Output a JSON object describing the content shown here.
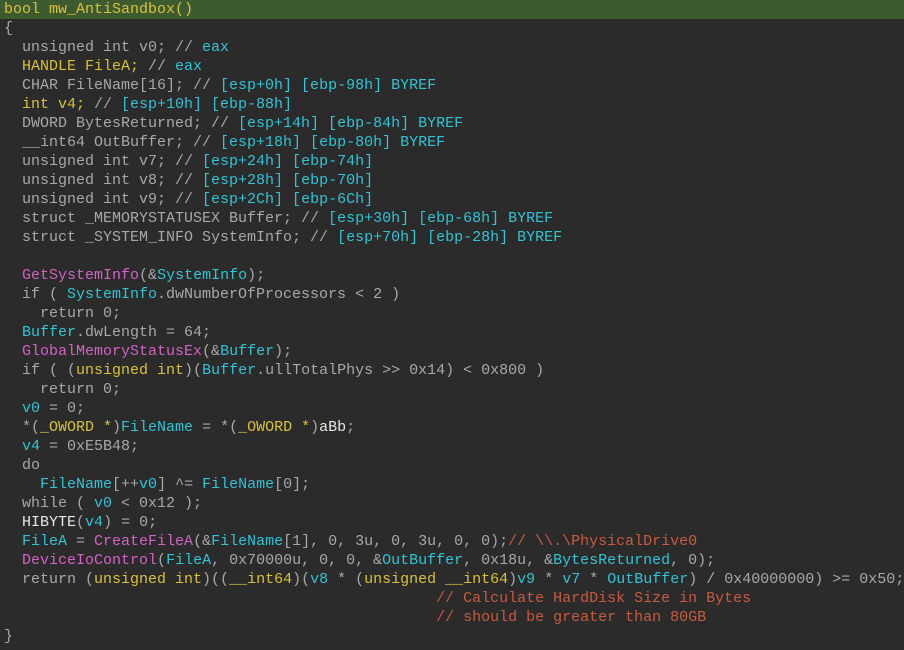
{
  "view": "pseudocode",
  "colors": {
    "background": "#2b2b2b",
    "header_bg": "#3e5b30",
    "text": "#a8a8a8",
    "keyword_type": "#d9c13a",
    "identifier": "#2fc4d6",
    "function": "#d361c6",
    "comment": "#c95a3e"
  },
  "code": {
    "lines": [
      [
        [
          "bool mw_AntiSandbox()",
          "y"
        ]
      ],
      [
        [
          "{",
          "g"
        ]
      ],
      [
        [
          "  unsigned int v0; // ",
          "g"
        ],
        [
          "eax",
          "c"
        ]
      ],
      [
        [
          "  HANDLE FileA; ",
          "y"
        ],
        [
          "// ",
          "g"
        ],
        [
          "eax",
          "c"
        ]
      ],
      [
        [
          "  CHAR FileName[16]; // ",
          "g"
        ],
        [
          "[esp+0h] [ebp-98h] BYREF",
          "c"
        ]
      ],
      [
        [
          "  int v4; ",
          "y"
        ],
        [
          "// ",
          "g"
        ],
        [
          "[esp+10h] [ebp-88h]",
          "c"
        ]
      ],
      [
        [
          "  DWORD BytesReturned; // ",
          "g"
        ],
        [
          "[esp+14h] [ebp-84h] BYREF",
          "c"
        ]
      ],
      [
        [
          "  __int64 OutBuffer; // ",
          "g"
        ],
        [
          "[esp+18h] [ebp-80h] BYREF",
          "c"
        ]
      ],
      [
        [
          "  unsigned int v7; // ",
          "g"
        ],
        [
          "[esp+24h] [ebp-74h]",
          "c"
        ]
      ],
      [
        [
          "  unsigned int v8; // ",
          "g"
        ],
        [
          "[esp+28h] [ebp-70h]",
          "c"
        ]
      ],
      [
        [
          "  unsigned int v9; // ",
          "g"
        ],
        [
          "[esp+2Ch] [ebp-6Ch]",
          "c"
        ]
      ],
      [
        [
          "  struct _MEMORYSTATUSEX Buffer; // ",
          "g"
        ],
        [
          "[esp+30h] [ebp-68h] BYREF",
          "c"
        ]
      ],
      [
        [
          "  struct _SYSTEM_INFO SystemInfo; // ",
          "g"
        ],
        [
          "[esp+70h] [ebp-28h] BYREF",
          "c"
        ]
      ],
      [
        [
          "",
          "g"
        ]
      ],
      [
        [
          "  ",
          "g"
        ],
        [
          "GetSystemInfo",
          "p"
        ],
        [
          "(&",
          "g"
        ],
        [
          "SystemInfo",
          "c"
        ],
        [
          ");",
          "g"
        ]
      ],
      [
        [
          "  if ( ",
          "g"
        ],
        [
          "SystemInfo",
          "c"
        ],
        [
          ".dwNumberOfProcessors < 2 )",
          "g"
        ]
      ],
      [
        [
          "    return 0;",
          "g"
        ]
      ],
      [
        [
          "  ",
          "g"
        ],
        [
          "Buffer",
          "c"
        ],
        [
          ".dwLength = 64;",
          "g"
        ]
      ],
      [
        [
          "  ",
          "g"
        ],
        [
          "GlobalMemoryStatusEx",
          "p"
        ],
        [
          "(&",
          "g"
        ],
        [
          "Buffer",
          "c"
        ],
        [
          ");",
          "g"
        ]
      ],
      [
        [
          "  if ( (",
          "g"
        ],
        [
          "unsigned int",
          "y"
        ],
        [
          ")(",
          "g"
        ],
        [
          "Buffer",
          "c"
        ],
        [
          ".ullTotalPhys >> 0x14) < 0x800 )",
          "g"
        ]
      ],
      [
        [
          "    return 0;",
          "g"
        ]
      ],
      [
        [
          "  ",
          "g"
        ],
        [
          "v0",
          "c"
        ],
        [
          " = 0;",
          "g"
        ]
      ],
      [
        [
          "  *(",
          "g"
        ],
        [
          "_OWORD *",
          "y"
        ],
        [
          ")",
          "g"
        ],
        [
          "FileName",
          "c"
        ],
        [
          " = *(",
          "g"
        ],
        [
          "_OWORD *",
          "y"
        ],
        [
          ")",
          "g"
        ],
        [
          "aBb",
          "w"
        ],
        [
          ";",
          "g"
        ]
      ],
      [
        [
          "  ",
          "g"
        ],
        [
          "v4",
          "c"
        ],
        [
          " = 0xE5B48;",
          "g"
        ]
      ],
      [
        [
          "  do",
          "g"
        ]
      ],
      [
        [
          "    ",
          "g"
        ],
        [
          "FileName",
          "c"
        ],
        [
          "[++",
          "g"
        ],
        [
          "v0",
          "c"
        ],
        [
          "] ^= ",
          "g"
        ],
        [
          "FileName",
          "c"
        ],
        [
          "[0];",
          "g"
        ]
      ],
      [
        [
          "  while ( ",
          "g"
        ],
        [
          "v0",
          "c"
        ],
        [
          " < 0x12 );",
          "g"
        ]
      ],
      [
        [
          "  ",
          "g"
        ],
        [
          "HIBYTE",
          "w"
        ],
        [
          "(",
          "g"
        ],
        [
          "v4",
          "c"
        ],
        [
          ") = 0;",
          "g"
        ]
      ],
      [
        [
          "  ",
          "g"
        ],
        [
          "FileA",
          "c"
        ],
        [
          " = ",
          "g"
        ],
        [
          "CreateFileA",
          "p"
        ],
        [
          "(&",
          "g"
        ],
        [
          "FileName",
          "c"
        ],
        [
          "[1], 0, 3u, 0, 3u, 0, 0);",
          "g"
        ],
        [
          "// \\\\.\\PhysicalDrive0",
          "r"
        ]
      ],
      [
        [
          "  ",
          "g"
        ],
        [
          "DeviceIoControl",
          "p"
        ],
        [
          "(",
          "g"
        ],
        [
          "FileA",
          "c"
        ],
        [
          ", 0x70000u, 0, 0, &",
          "g"
        ],
        [
          "OutBuffer",
          "c"
        ],
        [
          ", 0x18u, &",
          "g"
        ],
        [
          "BytesReturned",
          "c"
        ],
        [
          ", 0);",
          "g"
        ]
      ],
      [
        [
          "  return (",
          "g"
        ],
        [
          "unsigned int",
          "y"
        ],
        [
          ")((",
          "g"
        ],
        [
          "__int64",
          "y"
        ],
        [
          ")(",
          "g"
        ],
        [
          "v8",
          "c"
        ],
        [
          " * (",
          "g"
        ],
        [
          "unsigned __int64",
          "y"
        ],
        [
          ")",
          "g"
        ],
        [
          "v9",
          "c"
        ],
        [
          " * ",
          "g"
        ],
        [
          "v7",
          "c"
        ],
        [
          " * ",
          "g"
        ],
        [
          "OutBuffer",
          "c"
        ],
        [
          ") / 0x40000000) >= 0x50;",
          "g"
        ]
      ],
      [
        [
          "                                                ",
          "g"
        ],
        [
          "// Calculate HardDisk Size in Bytes",
          "r"
        ]
      ],
      [
        [
          "                                                ",
          "g"
        ],
        [
          "// should be greater than 80GB",
          "r"
        ]
      ],
      [
        [
          "}",
          "g"
        ]
      ]
    ]
  }
}
